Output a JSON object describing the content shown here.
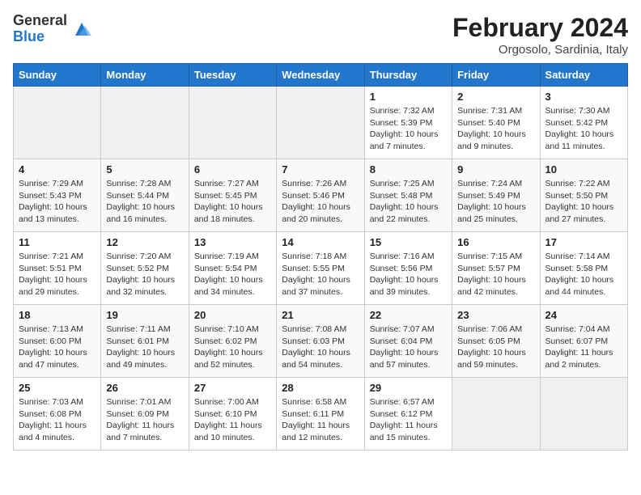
{
  "logo": {
    "general": "General",
    "blue": "Blue"
  },
  "title": "February 2024",
  "subtitle": "Orgosolo, Sardinia, Italy",
  "days_of_week": [
    "Sunday",
    "Monday",
    "Tuesday",
    "Wednesday",
    "Thursday",
    "Friday",
    "Saturday"
  ],
  "weeks": [
    [
      {
        "day": "",
        "info": ""
      },
      {
        "day": "",
        "info": ""
      },
      {
        "day": "",
        "info": ""
      },
      {
        "day": "",
        "info": ""
      },
      {
        "day": "1",
        "info": "Sunrise: 7:32 AM\nSunset: 5:39 PM\nDaylight: 10 hours and 7 minutes."
      },
      {
        "day": "2",
        "info": "Sunrise: 7:31 AM\nSunset: 5:40 PM\nDaylight: 10 hours and 9 minutes."
      },
      {
        "day": "3",
        "info": "Sunrise: 7:30 AM\nSunset: 5:42 PM\nDaylight: 10 hours and 11 minutes."
      }
    ],
    [
      {
        "day": "4",
        "info": "Sunrise: 7:29 AM\nSunset: 5:43 PM\nDaylight: 10 hours and 13 minutes."
      },
      {
        "day": "5",
        "info": "Sunrise: 7:28 AM\nSunset: 5:44 PM\nDaylight: 10 hours and 16 minutes."
      },
      {
        "day": "6",
        "info": "Sunrise: 7:27 AM\nSunset: 5:45 PM\nDaylight: 10 hours and 18 minutes."
      },
      {
        "day": "7",
        "info": "Sunrise: 7:26 AM\nSunset: 5:46 PM\nDaylight: 10 hours and 20 minutes."
      },
      {
        "day": "8",
        "info": "Sunrise: 7:25 AM\nSunset: 5:48 PM\nDaylight: 10 hours and 22 minutes."
      },
      {
        "day": "9",
        "info": "Sunrise: 7:24 AM\nSunset: 5:49 PM\nDaylight: 10 hours and 25 minutes."
      },
      {
        "day": "10",
        "info": "Sunrise: 7:22 AM\nSunset: 5:50 PM\nDaylight: 10 hours and 27 minutes."
      }
    ],
    [
      {
        "day": "11",
        "info": "Sunrise: 7:21 AM\nSunset: 5:51 PM\nDaylight: 10 hours and 29 minutes."
      },
      {
        "day": "12",
        "info": "Sunrise: 7:20 AM\nSunset: 5:52 PM\nDaylight: 10 hours and 32 minutes."
      },
      {
        "day": "13",
        "info": "Sunrise: 7:19 AM\nSunset: 5:54 PM\nDaylight: 10 hours and 34 minutes."
      },
      {
        "day": "14",
        "info": "Sunrise: 7:18 AM\nSunset: 5:55 PM\nDaylight: 10 hours and 37 minutes."
      },
      {
        "day": "15",
        "info": "Sunrise: 7:16 AM\nSunset: 5:56 PM\nDaylight: 10 hours and 39 minutes."
      },
      {
        "day": "16",
        "info": "Sunrise: 7:15 AM\nSunset: 5:57 PM\nDaylight: 10 hours and 42 minutes."
      },
      {
        "day": "17",
        "info": "Sunrise: 7:14 AM\nSunset: 5:58 PM\nDaylight: 10 hours and 44 minutes."
      }
    ],
    [
      {
        "day": "18",
        "info": "Sunrise: 7:13 AM\nSunset: 6:00 PM\nDaylight: 10 hours and 47 minutes."
      },
      {
        "day": "19",
        "info": "Sunrise: 7:11 AM\nSunset: 6:01 PM\nDaylight: 10 hours and 49 minutes."
      },
      {
        "day": "20",
        "info": "Sunrise: 7:10 AM\nSunset: 6:02 PM\nDaylight: 10 hours and 52 minutes."
      },
      {
        "day": "21",
        "info": "Sunrise: 7:08 AM\nSunset: 6:03 PM\nDaylight: 10 hours and 54 minutes."
      },
      {
        "day": "22",
        "info": "Sunrise: 7:07 AM\nSunset: 6:04 PM\nDaylight: 10 hours and 57 minutes."
      },
      {
        "day": "23",
        "info": "Sunrise: 7:06 AM\nSunset: 6:05 PM\nDaylight: 10 hours and 59 minutes."
      },
      {
        "day": "24",
        "info": "Sunrise: 7:04 AM\nSunset: 6:07 PM\nDaylight: 11 hours and 2 minutes."
      }
    ],
    [
      {
        "day": "25",
        "info": "Sunrise: 7:03 AM\nSunset: 6:08 PM\nDaylight: 11 hours and 4 minutes."
      },
      {
        "day": "26",
        "info": "Sunrise: 7:01 AM\nSunset: 6:09 PM\nDaylight: 11 hours and 7 minutes."
      },
      {
        "day": "27",
        "info": "Sunrise: 7:00 AM\nSunset: 6:10 PM\nDaylight: 11 hours and 10 minutes."
      },
      {
        "day": "28",
        "info": "Sunrise: 6:58 AM\nSunset: 6:11 PM\nDaylight: 11 hours and 12 minutes."
      },
      {
        "day": "29",
        "info": "Sunrise: 6:57 AM\nSunset: 6:12 PM\nDaylight: 11 hours and 15 minutes."
      },
      {
        "day": "",
        "info": ""
      },
      {
        "day": "",
        "info": ""
      }
    ]
  ]
}
